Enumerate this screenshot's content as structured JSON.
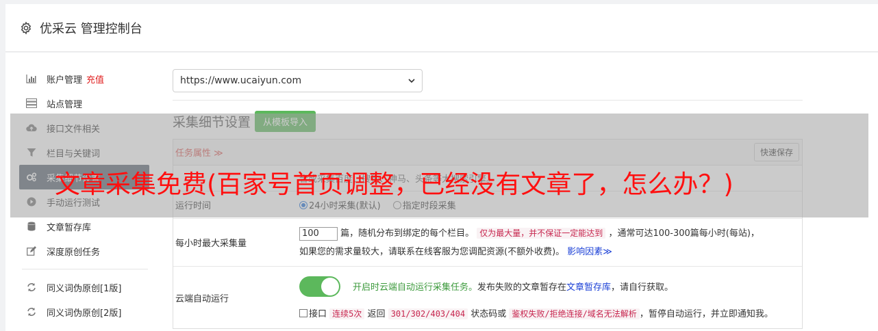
{
  "header": {
    "title": "优采云 管理控制台"
  },
  "sidebar": {
    "items": [
      {
        "label": "账户管理",
        "extra": "充值",
        "icon": "bar-chart-icon"
      },
      {
        "label": "站点管理",
        "icon": "server-icon"
      },
      {
        "label": "接口文件相关",
        "icon": "cloud-upload-icon"
      },
      {
        "label": "栏目与关键词",
        "icon": "filter-icon"
      },
      {
        "label": "采集细节设置",
        "icon": "gears-icon"
      },
      {
        "label": "手动运行测试",
        "icon": "play-circle-icon"
      },
      {
        "label": "文章暂存库",
        "icon": "database-icon"
      },
      {
        "label": "深度原创任务",
        "icon": "edit-icon"
      },
      {
        "label": "同义词伪原创[1版]",
        "icon": "refresh-icon"
      },
      {
        "label": "同义词伪原创[2版]",
        "icon": "refresh-icon"
      }
    ]
  },
  "site_select": {
    "value": "https://www.ucaiyun.com"
  },
  "section": {
    "title": "采集细节设置",
    "import_button": "从模板导入"
  },
  "panel": {
    "task_attr": "任务属性 ≫",
    "save_button": "快速保存",
    "hidden_row_text": "合或采集百度、搜狗、神马、头条等大搜索引擎。",
    "runtime": {
      "label": "运行时间",
      "opt1": "24小时采集(默认)",
      "opt2": "指定时段采集"
    },
    "maxrate": {
      "label": "每小时最大采集量",
      "value": "100",
      "text1": "篇，随机分布到绑定的每个栏目。",
      "code": "仅为最大量，并不保证一定能达到",
      "text2": "，通常可达100-300篇每小时(每站)，",
      "text3": "如果您的需求量较大，请联系在线客服为您调配资源(不额外收费)。",
      "link": "影响因素≫"
    },
    "cloud": {
      "label": "云端自动运行",
      "green_text": "开启时云端自动运行采集任务。",
      "text_a": "发布失败的文章暂存在",
      "link": "文章暂存库",
      "text_b": "，请自行获取。",
      "cb_label": "接口",
      "code1": "连续5次",
      "text_c": "返回",
      "code2": "301/302/403/404",
      "text_d": "状态码或",
      "code3": "鉴权失败/拒绝连接/域名无法解析",
      "text_e": "，暂停自动运行，并立即通知我。"
    }
  },
  "overlay_headline": "文章采集免费(百家号首页调整，已经没有文章了，怎么办？)",
  "colors": {
    "accent_green": "#5cb85c",
    "active_nav": "#5a6472",
    "headline": "#ff1010"
  }
}
